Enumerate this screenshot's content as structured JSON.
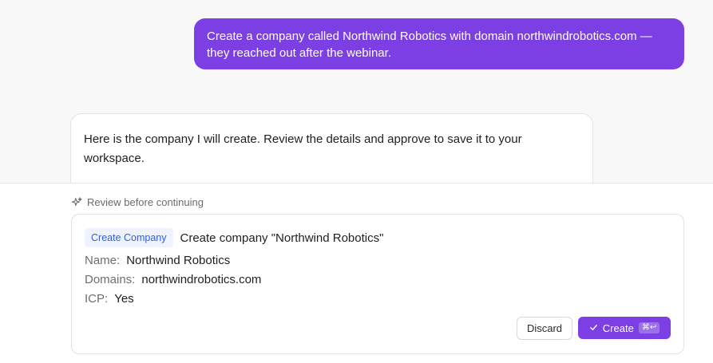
{
  "conversation": {
    "user_message": "Create a company called Northwind Robotics with domain northwindrobotics.com — they reached out after the webinar.",
    "assistant_message": "Here is the company I will create. Review the details and approve to save it to your workspace."
  },
  "review": {
    "header_label": "Review before continuing",
    "action_badge": "Create Company",
    "action_title": "Create company \"Northwind Robotics\"",
    "fields": [
      {
        "label": "Name:",
        "value": "Northwind Robotics"
      },
      {
        "label": "Domains:",
        "value": "northwindrobotics.com"
      },
      {
        "label": "ICP:",
        "value": "Yes"
      }
    ],
    "discard_label": "Discard",
    "create_label": "Create",
    "create_shortcut": "⌘↩"
  },
  "colors": {
    "accent": "#7b3fe4",
    "badge_bg": "#eef3ff",
    "badge_text": "#2f5ee0"
  },
  "icons": {
    "review_header": "sparkles-icon",
    "create_button": "check-icon"
  }
}
